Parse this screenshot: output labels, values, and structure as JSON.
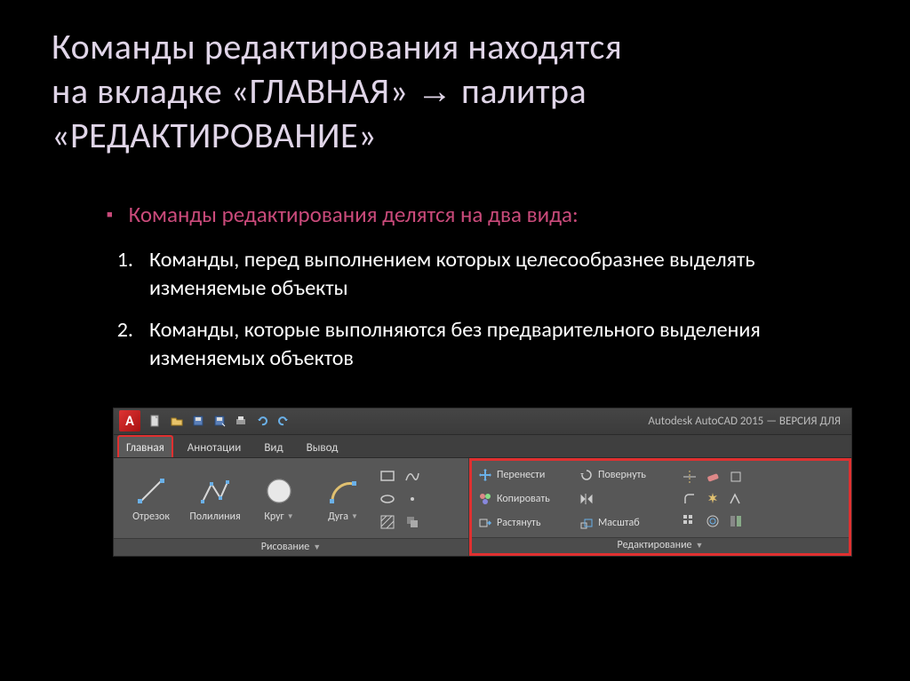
{
  "title": {
    "line1": "Команды редактирования находятся",
    "line2": "на вкладке «ГЛАВНАЯ» ",
    "arrow": "→",
    "line2b": " палитра",
    "line3": "«РЕДАКТИРОВАНИЕ»"
  },
  "bullet": "Команды редактирования делятся на два вида:",
  "list": [
    {
      "num": "1.",
      "text": "Команды, перед выполнением которых целесообразнее выделять изменяемые объекты"
    },
    {
      "num": "2.",
      "text": "Команды, которые выполняются без предварительного выделения изменяемых объектов"
    }
  ],
  "acad": {
    "logo": "A",
    "app_title": "Autodesk AutoCAD 2015 — ВЕРСИЯ ДЛЯ",
    "tabs": [
      "Главная",
      "Аннотации",
      "Вид",
      "Вывод"
    ],
    "draw": {
      "title": "Рисование",
      "tools": [
        "Отрезок",
        "Полилиния",
        "Круг",
        "Дуга"
      ]
    },
    "edit": {
      "title": "Редактирование",
      "left": [
        "Перенести",
        "Копировать",
        "Растянуть"
      ],
      "right": [
        "Повернуть",
        "Масштаб"
      ]
    }
  }
}
